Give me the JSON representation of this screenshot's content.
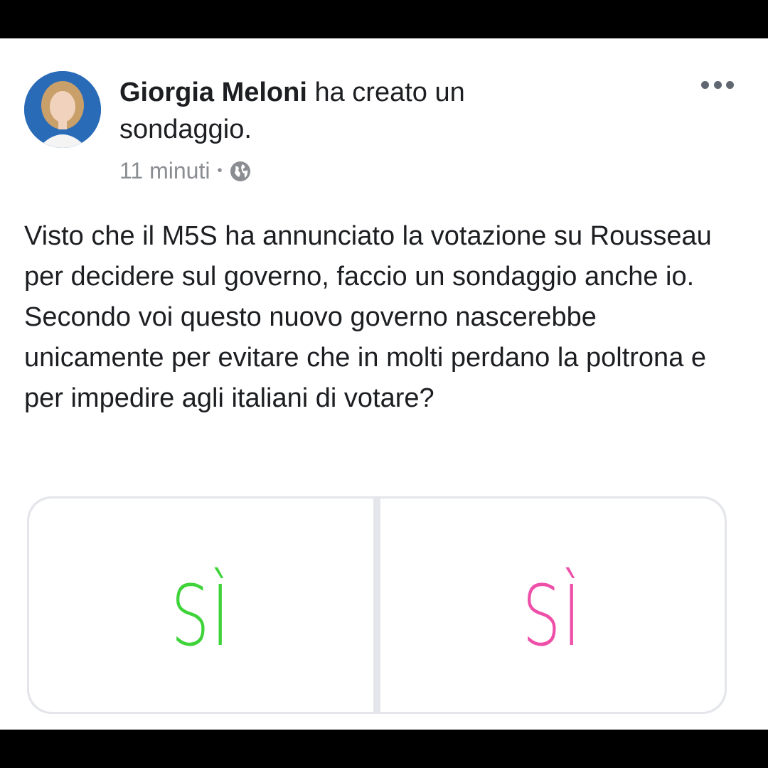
{
  "post": {
    "author": "Giorgia Meloni",
    "action": " ha creato un sondaggio.",
    "time": "11 minuti",
    "separator": "•",
    "privacy_icon": "globe-icon",
    "more_icon": "more-options-icon",
    "body_lines": [
      "Visto che il M5S ha annunciato la votazione su Rousseau per decidere sul governo, faccio un sondaggio anche io.",
      "Secondo voi questo nuovo governo nascerebbe unicamente per evitare che in molti perdano la poltrona e per impedire agli italiani di votare?"
    ]
  },
  "poll": {
    "options": [
      {
        "label": "SÌ",
        "color": "#3fd33a"
      },
      {
        "label": "SÌ",
        "color": "#ee4fa8"
      }
    ]
  },
  "colors": {
    "frame": "#000000",
    "card": "#ffffff",
    "text": "#1c1e21",
    "meta": "#8a8d91",
    "poll_border": "#e4e6eb",
    "avatar_bg": "#1f5fa8"
  }
}
